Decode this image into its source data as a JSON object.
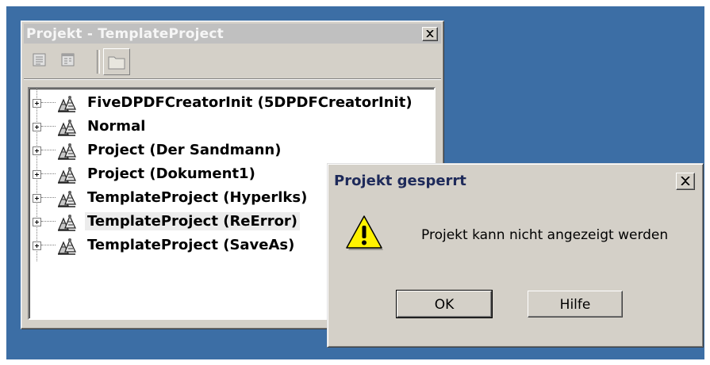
{
  "project_explorer": {
    "title": "Projekt - TemplateProject",
    "toolbar": [
      {
        "icon": "view-code-icon"
      },
      {
        "icon": "view-object-icon"
      },
      {
        "icon": "toggle-folders-icon"
      }
    ],
    "items": [
      {
        "label": "FiveDPDFCreatorInit (5DPDFCreatorInit)",
        "selected": false
      },
      {
        "label": "Normal",
        "selected": false
      },
      {
        "label": "Project (Der Sandmann)",
        "selected": false
      },
      {
        "label": "Project (Dokument1)",
        "selected": false
      },
      {
        "label": "TemplateProject (Hyperlks)",
        "selected": false
      },
      {
        "label": "TemplateProject (ReError)",
        "selected": true
      },
      {
        "label": "TemplateProject (SaveAs)",
        "selected": false
      }
    ]
  },
  "dialog": {
    "title": "Projekt gesperrt",
    "message": "Projekt kann nicht angezeigt werden",
    "icon": "warning-icon",
    "ok_label": "OK",
    "help_label": "Hilfe"
  },
  "colors": {
    "desktop": "#3c6ea5",
    "window_face": "#d4d0c8",
    "dialog_title_text": "#1e2a5a"
  }
}
